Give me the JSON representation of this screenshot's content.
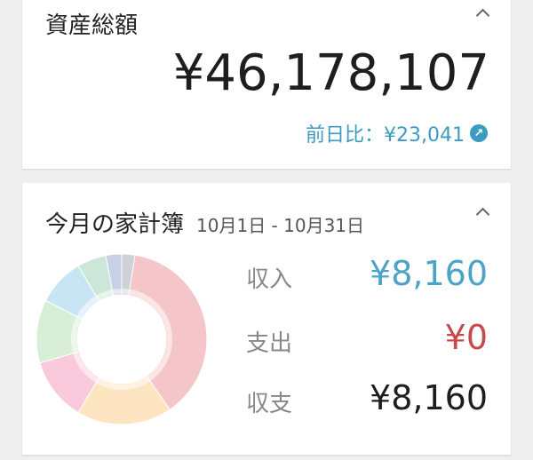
{
  "assets_card": {
    "title": "資産総額",
    "total": "¥46,178,107",
    "change_label": "前日比：¥23,041",
    "change_icon": "arrow-up-right-icon"
  },
  "budget_card": {
    "title": "今月の家計簿",
    "date_range": "10月1日 - 10月31日",
    "income_label": "収入",
    "income_value": "¥8,160",
    "expense_label": "支出",
    "expense_value": "¥0",
    "balance_label": "収支",
    "balance_value": "¥8,160",
    "donut_colors": [
      "#f5c6c9",
      "#fde5c2",
      "#f9c9dc",
      "#d8eed6",
      "#c7e5f3",
      "#cce7d8",
      "#c8cfe6",
      "#cfd1d8"
    ],
    "donut_fractions": [
      0.405,
      0.18,
      0.12,
      0.12,
      0.09,
      0.055,
      0.03,
      0.025
    ]
  }
}
